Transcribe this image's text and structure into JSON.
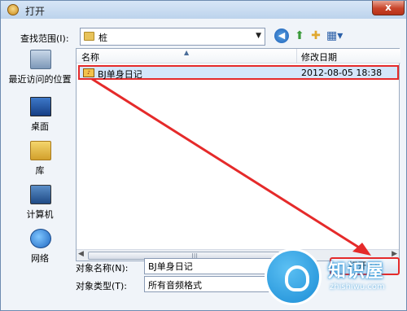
{
  "window": {
    "title": "打开",
    "close_label": "x"
  },
  "lookin": {
    "label": "查找范围(I):",
    "value": "桩"
  },
  "sidebar": {
    "items": [
      {
        "label": "最近访问的位置",
        "icon": "recent-places-icon"
      },
      {
        "label": "桌面",
        "icon": "desktop-icon"
      },
      {
        "label": "库",
        "icon": "library-icon"
      },
      {
        "label": "计算机",
        "icon": "computer-icon"
      },
      {
        "label": "网络",
        "icon": "network-icon"
      }
    ]
  },
  "filelist": {
    "columns": [
      "名称",
      "修改日期"
    ],
    "files": [
      {
        "name": "BJ单身日记",
        "modified": "2012-08-05 18:38"
      }
    ]
  },
  "filename": {
    "label": "对象名称(N):",
    "value": "BJ单身日记"
  },
  "filetype": {
    "label": "对象类型(T):",
    "value": "所有音频格式"
  },
  "open_button": {
    "label": "打开(O)"
  },
  "watermark": {
    "text": "知识屋",
    "url": "zhishiwu.com"
  },
  "colors": {
    "accent": "#e52a2a",
    "selection": "#d4e6fa",
    "title_bg": "#bcd3ec"
  }
}
